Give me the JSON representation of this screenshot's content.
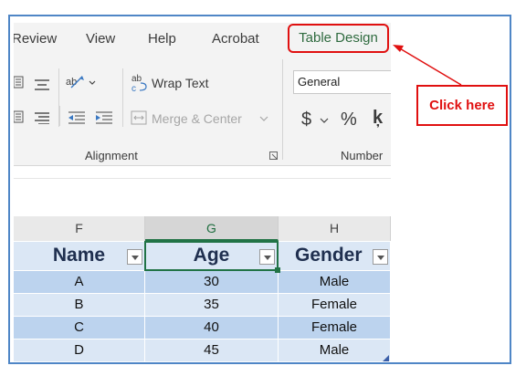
{
  "ribbon": {
    "tabs": [
      {
        "label": "Review"
      },
      {
        "label": "View"
      },
      {
        "label": "Help"
      },
      {
        "label": "Acrobat"
      },
      {
        "label": "Table Design"
      }
    ],
    "wrap_text": "Wrap Text",
    "merge_center": "Merge & Center",
    "alignment_group": "Alignment",
    "number_format": "General",
    "currency": "$",
    "percent": "%",
    "comma": "ķ",
    "number_group": "Number",
    "icons": [
      "align-left-icon",
      "align-center-icon",
      "orientation-icon",
      "decrease-indent-icon",
      "increase-indent-icon",
      "wrap-text-icon",
      "merge-center-icon",
      "dialog-launcher-icon"
    ]
  },
  "columns": [
    "F",
    "G",
    "H"
  ],
  "table": {
    "headers": [
      "Name",
      "Age",
      "Gender"
    ],
    "rows": [
      [
        "A",
        "30",
        "Male"
      ],
      [
        "B",
        "35",
        "Female"
      ],
      [
        "C",
        "40",
        "Female"
      ],
      [
        "D",
        "45",
        "Male"
      ]
    ]
  },
  "callout": "Click here",
  "colors": {
    "accent_red": "#e01010",
    "excel_green": "#217346",
    "table_dark": "#bcd3ee",
    "table_light": "#dbe7f5"
  }
}
